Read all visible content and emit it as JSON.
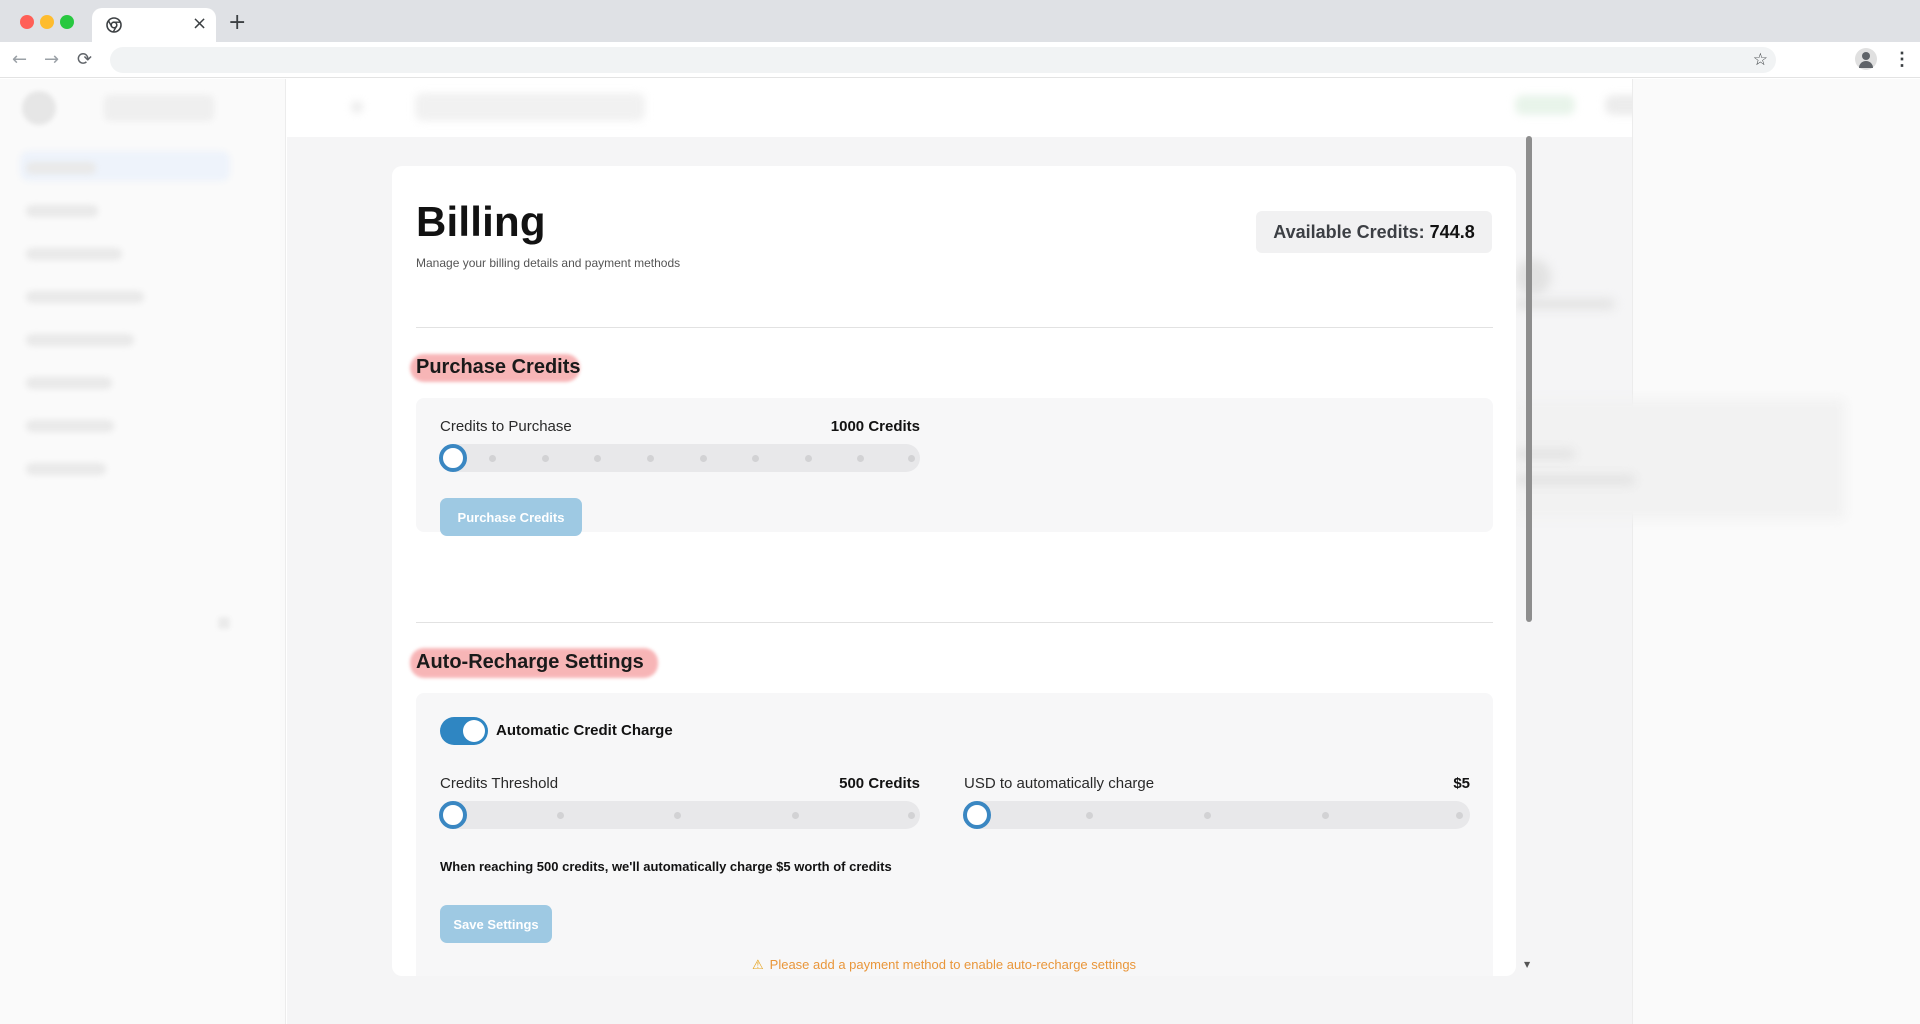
{
  "browser": {
    "tab_close": "×",
    "new_tab": "+",
    "back": "←",
    "forward": "→",
    "reload": "⟳",
    "bookmark_star": "☆",
    "menu": "⋮"
  },
  "billing": {
    "title": "Billing",
    "subtitle": "Manage your billing details and payment methods",
    "available_credits_label": "Available Credits:",
    "available_credits_value": "744.8"
  },
  "purchase": {
    "section_title": "Purchase Credits",
    "slider_label": "Credits to Purchase",
    "slider_value": "1000 Credits",
    "slider_level": 0,
    "button_label": "Purchase Credits"
  },
  "auto_recharge": {
    "section_title": "Auto-Recharge Settings",
    "toggle_label": "Automatic Credit Charge",
    "toggle_on": true,
    "threshold_label": "Credits Threshold",
    "threshold_value": "500 Credits",
    "threshold_level": 0,
    "usd_label": "USD to automatically charge",
    "usd_value": "$5",
    "usd_level": 0,
    "explainer": "When reaching 500 credits, we'll automatically charge $5 worth of credits",
    "save_button": "Save Settings",
    "warning_icon": "⚠",
    "warning_text": "Please add a payment method to enable auto-recharge settings"
  },
  "colors": {
    "accent": "#3a87c2",
    "button_disabled": "#9ec9e3",
    "highlight": "#f6a3a5",
    "warning": "#e9963a"
  }
}
